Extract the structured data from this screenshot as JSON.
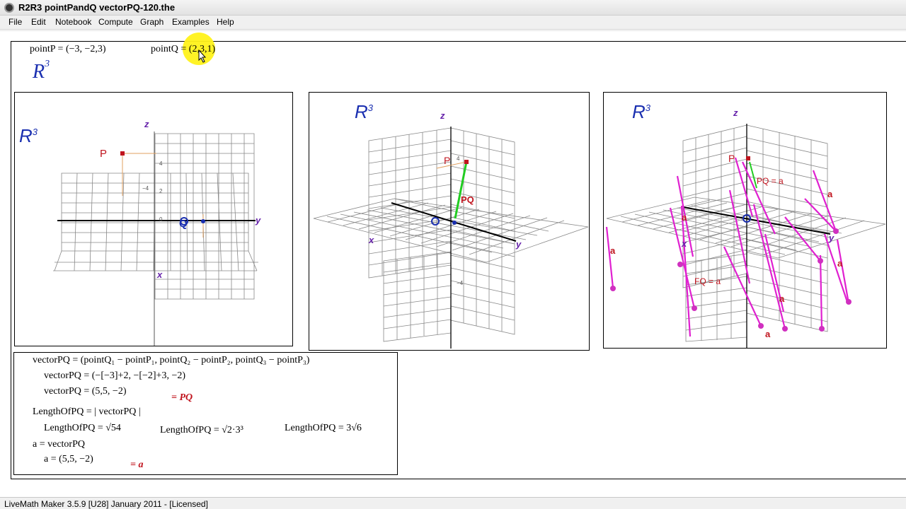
{
  "window": {
    "title": "R2R3 pointPandQ vectorPQ-120.the"
  },
  "menu": [
    "File",
    "Edit",
    "Notebook",
    "Compute",
    "Graph",
    "Examples",
    "Help"
  ],
  "header": {
    "pointP": "pointP = (−3, −2,3)",
    "pointQ": "pointQ = (2,3,1)",
    "r3_main": "R",
    "r3_sup": "3"
  },
  "graphs": {
    "label_R": "R",
    "label_sup": "3",
    "axis_z": "z",
    "axis_y": "y",
    "axis_x": "x",
    "P": "P",
    "Q": "Q",
    "PQ": "PQ",
    "a": "a",
    "PQ_eq_a": "PQ = a",
    "FQ_eq_a": "FQ = a",
    "tick_4": "4",
    "tick_2": "2",
    "tick_0": "0",
    "tick_m4": "−4"
  },
  "formula": {
    "line1": "vectorPQ = (pointQ₁ − pointP₁, pointQ₂ − pointP₂, pointQ₃ − pointP₃)",
    "line2": "vectorPQ = (−[−3]+2, −[−2]+3, −2)",
    "line3": "vectorPQ = (5,5, −2)",
    "line3_eq": "= PQ",
    "line4": "LengthOfPQ = | vectorPQ |",
    "line5a": "LengthOfPQ = √54",
    "line5b": "LengthOfPQ = √2·3³",
    "line5c": "LengthOfPQ = 3√6",
    "line6": "a = vectorPQ",
    "line7": "a = (5,5, −2)",
    "line7_eq": "= a"
  },
  "status": "LiveMath Maker 3.5.9 [U28] January 2011 - [Licensed]",
  "colors": {
    "r3_blue": "#1a2fb0",
    "point_red": "#c0141e",
    "vector_green": "#22cc22",
    "vector_magenta": "#e020d0",
    "highlight": "#fff21a"
  }
}
